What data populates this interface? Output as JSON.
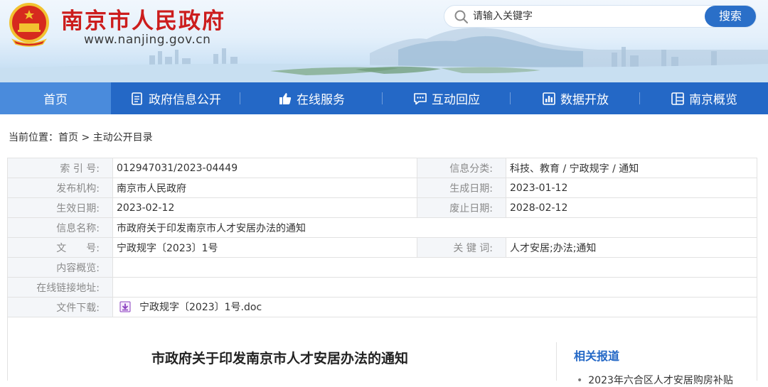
{
  "header": {
    "site_title": "南京市人民政府",
    "site_url": "www.nanjing.gov.cn",
    "search_placeholder": "请输入关键字",
    "search_button": "搜索"
  },
  "nav": {
    "items": [
      {
        "label": "首页",
        "icon": "",
        "active": true
      },
      {
        "label": "政府信息公开",
        "icon": "document-icon",
        "active": false
      },
      {
        "label": "在线服务",
        "icon": "thumbs-up-icon",
        "active": false
      },
      {
        "label": "互动回应",
        "icon": "chat-icon",
        "active": false
      },
      {
        "label": "数据开放",
        "icon": "bar-chart-icon",
        "active": false
      },
      {
        "label": "南京概览",
        "icon": "grid-icon",
        "active": false
      }
    ]
  },
  "breadcrumb": {
    "prefix": "当前位置：",
    "home": "首页",
    "separator": ">",
    "current": "主动公开目录"
  },
  "info": {
    "index_label": "索 引 号:",
    "index_value": "012947031/2023-04449",
    "category_label": "信息分类:",
    "category_value": "科技、教育 / 宁政规字 / 通知",
    "publisher_label": "发布机构:",
    "publisher_value": "南京市人民政府",
    "created_label": "生成日期:",
    "created_value": "2023-01-12",
    "effective_label": "生效日期:",
    "effective_value": "2023-02-12",
    "expire_label": "废止日期:",
    "expire_value": "2028-02-12",
    "name_label": "信息名称:",
    "name_value": "市政府关于印发南京市人才安居办法的通知",
    "docno_label": "文　　号:",
    "docno_value": "宁政规字〔2023〕1号",
    "keywords_label": "关 键 词:",
    "keywords_value": "人才安居;办法;通知",
    "summary_label": "内容概览:",
    "summary_value": "",
    "link_label": "在线链接地址:",
    "link_value": "",
    "file_label": "文件下载:",
    "file_value": "宁政规字〔2023〕1号.doc"
  },
  "article": {
    "title": "市政府关于印发南京市人才安居办法的通知"
  },
  "sidebar": {
    "related_title": "相关报道",
    "related_item": "2023年六合区人才安居购房补贴"
  },
  "colors": {
    "brand_red": "#cc1d1d",
    "nav_blue": "#2468c6",
    "nav_active": "#4a8bdc",
    "search_button": "#2a6fc8",
    "label_bg": "#f4f6f9"
  }
}
